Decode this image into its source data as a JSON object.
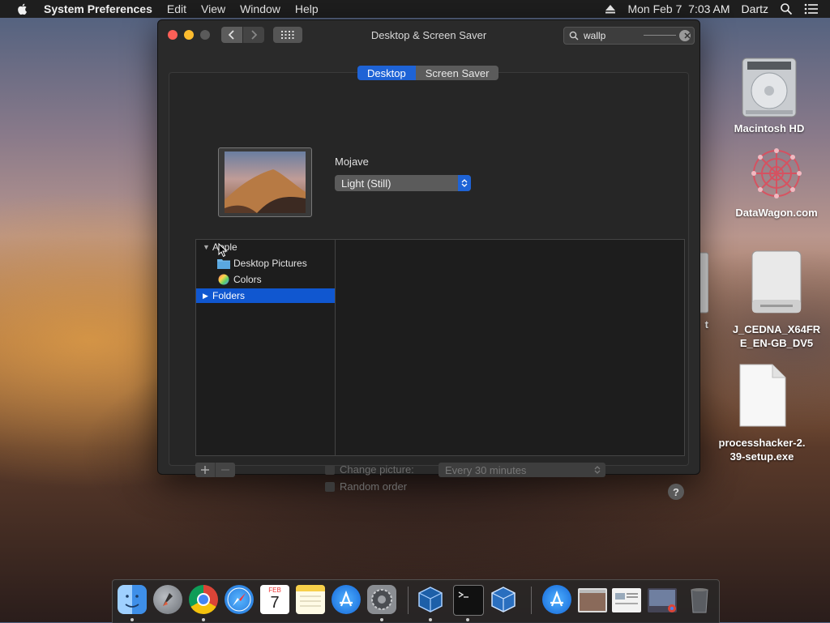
{
  "menubar": {
    "app_name": "System Preferences",
    "items": [
      "Edit",
      "View",
      "Window",
      "Help"
    ],
    "datetime": "Mon Feb 7  7:03 AM",
    "user": "Dartz"
  },
  "window": {
    "title": "Desktop & Screen Saver",
    "search_value": "wallp",
    "tabs": [
      "Desktop",
      "Screen Saver"
    ],
    "selected_tab": "Desktop",
    "wallpaper_name": "Mojave",
    "appearance_value": "Light (Still)",
    "sources": {
      "apple_group": "Apple",
      "items": [
        "Desktop Pictures",
        "Colors"
      ],
      "folders": "Folders"
    },
    "change_picture_label": "Change picture:",
    "interval_value": "Every 30 minutes",
    "random_order_label": "Random order",
    "help_label": "?"
  },
  "desktop_icons": {
    "macintosh_hd": "Macintosh HD",
    "datawagon": "DataWagon.com",
    "partial_label": "t",
    "cedna_line1": "J_CEDNA_X64FR",
    "cedna_line2": "E_EN-GB_DV5",
    "processhacker_line1": "processhacker-2.",
    "processhacker_line2": "39-setup.exe"
  },
  "dock": {
    "calendar_month": "FEB",
    "calendar_day": "7",
    "apps": [
      "finder-icon",
      "launchpad-icon",
      "chrome-icon",
      "safari-icon",
      "calendar-icon",
      "notes-icon",
      "app-store-icon",
      "system-preferences-icon",
      "virtualbox-icon",
      "terminal-icon",
      "virtualbox-vm-icon",
      "app-store-downloads-icon",
      "preview-window-icon",
      "document-window-icon",
      "chrome-window-icon",
      "trash-icon"
    ]
  },
  "colors": {
    "accent": "#1e63d6",
    "selection": "#1057d0"
  }
}
